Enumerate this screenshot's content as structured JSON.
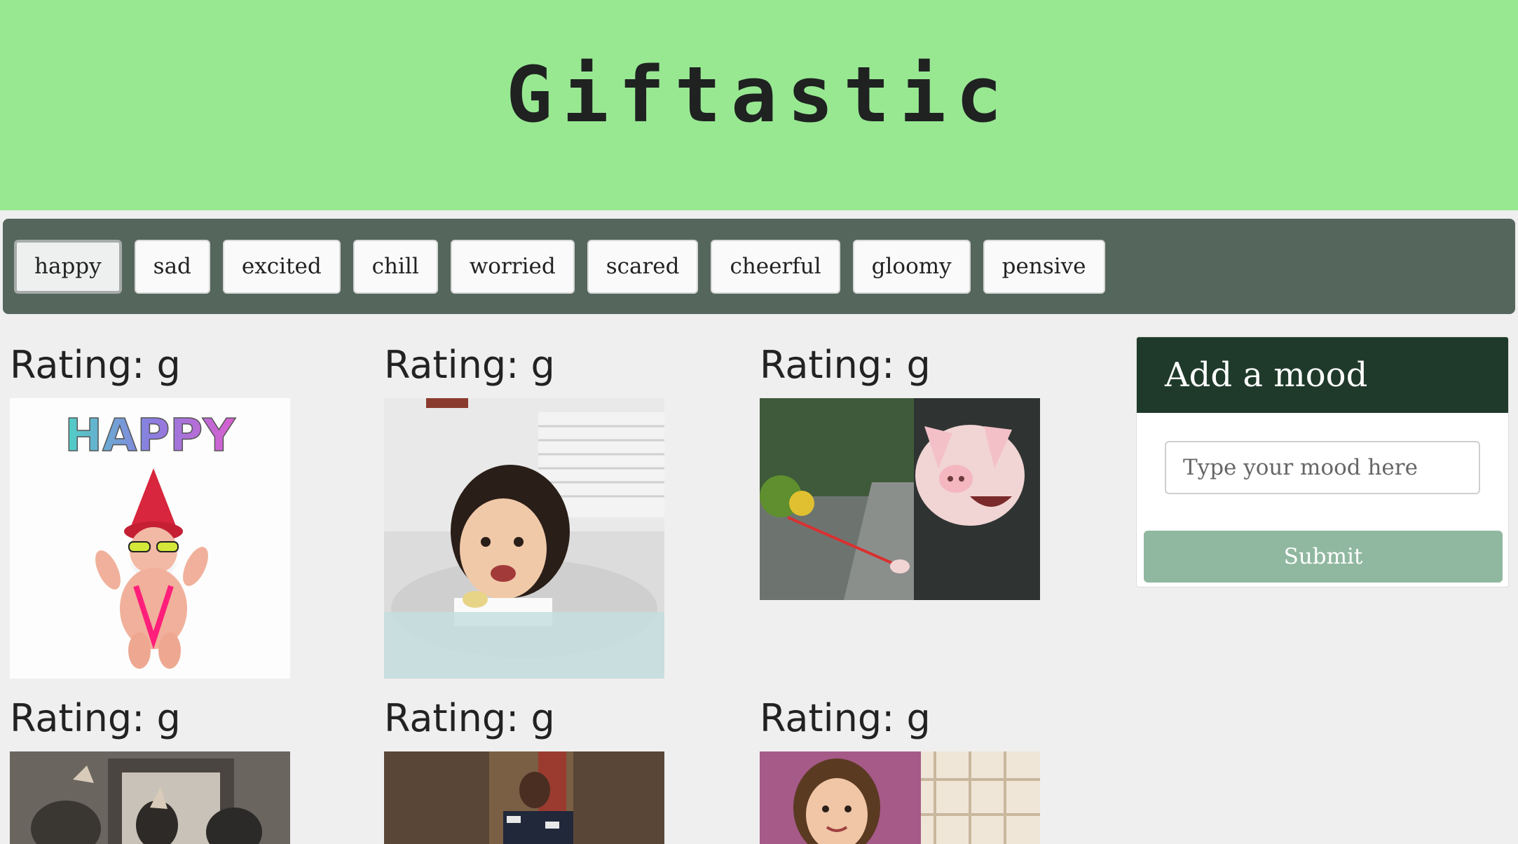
{
  "header": {
    "title": "Giftastic"
  },
  "moods": [
    "happy",
    "sad",
    "excited",
    "chill",
    "worried",
    "scared",
    "cheerful",
    "gloomy",
    "pensive"
  ],
  "active_mood": "happy",
  "gifs": [
    {
      "rating": "Rating: g",
      "image": "dancing-gnome-happy-gif",
      "caption": "HAPPY"
    },
    {
      "rating": "Rating: g",
      "image": "smiling-toddler-gif"
    },
    {
      "rating": "Rating: g",
      "image": "pig-out-car-window-gif"
    },
    {
      "rating": "Rating: g",
      "image": "cheering-crowd-gif"
    },
    {
      "rating": "Rating: g",
      "image": "man-dancing-gif"
    },
    {
      "rating": "Rating: g",
      "image": "little-girl-gif"
    }
  ],
  "add_mood": {
    "title": "Add a mood",
    "placeholder": "Type your mood here",
    "submit_label": "Submit"
  },
  "colors": {
    "header_bg": "#98e892",
    "button_bar_bg": "#55665d",
    "panel_header_bg": "#1f3a2a",
    "submit_bg": "#90b8a0"
  }
}
